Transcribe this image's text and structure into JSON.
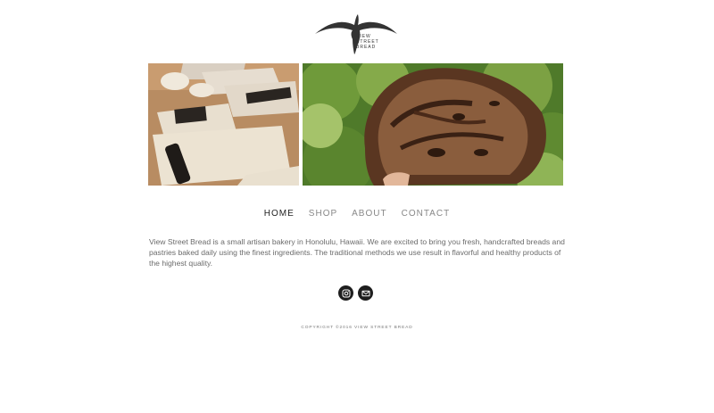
{
  "brand": {
    "logo_text": "VIEW STREET BREAD",
    "accent_color": "#333333",
    "logo_icon": "frigatebird-icon"
  },
  "hero": {
    "left_image": "pastry-dough-photo",
    "right_image": "bread-loaf-photo"
  },
  "nav": {
    "items": [
      {
        "label": "HOME",
        "active": true
      },
      {
        "label": "SHOP",
        "active": false
      },
      {
        "label": "ABOUT",
        "active": false
      },
      {
        "label": "CONTACT",
        "active": false
      }
    ]
  },
  "intro": {
    "text": "View Street Bread is a small artisan bakery in Honolulu, Hawaii. We are excited to bring you fresh, handcrafted breads and pastries baked daily using the finest ingredients. The traditional methods we use result in flavorful and healthy products of the highest quality."
  },
  "social": {
    "icons": [
      "instagram-icon",
      "email-icon"
    ]
  },
  "footer": {
    "copyright": "COPYRIGHT ©2016 VIEW STREET BREAD"
  }
}
